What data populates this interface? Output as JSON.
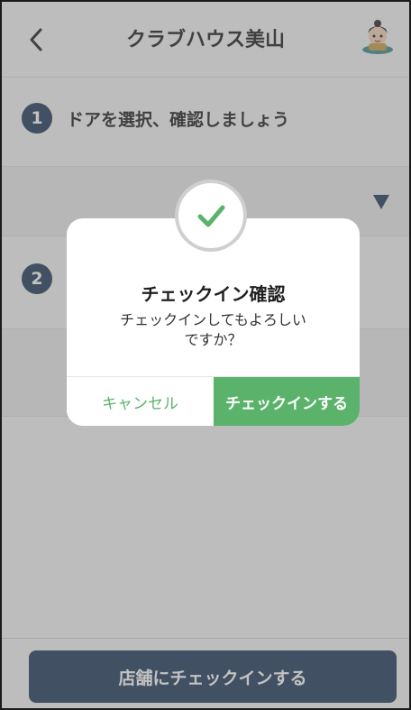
{
  "header": {
    "back_icon": "chevron-left-icon",
    "title": "クラブハウス美山",
    "avatar_icon": "character-avatar-icon"
  },
  "steps": [
    {
      "number": "1",
      "label": "ドアを選択、確認しましょう"
    },
    {
      "number": "2",
      "label": ""
    }
  ],
  "door_select": {
    "value": "",
    "icon": "triangle-down-icon"
  },
  "dialog": {
    "icon": "checkmark-icon",
    "title": "チェックイン確認",
    "message_line1": "チェックインしてもよろしい",
    "message_line2": "ですか？",
    "cancel_label": "キャンセル",
    "confirm_label": "チェックインする"
  },
  "footer": {
    "checkin_store_label": "店舗にチェックインする"
  },
  "colors": {
    "primary_navy": "#223b5a",
    "accent_green": "#5bb36b"
  }
}
